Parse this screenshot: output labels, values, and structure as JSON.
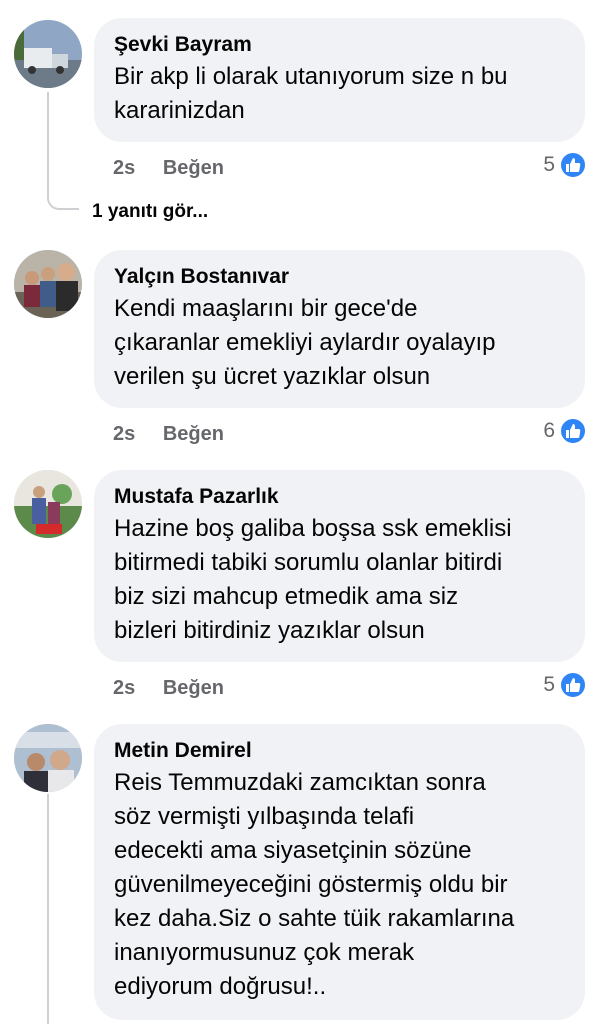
{
  "comments": [
    {
      "author": "Şevki Bayram",
      "text": "Bir akp li olarak utanıyorum size n bu\nkararinizdan",
      "time": "2s",
      "like_label": "Beğen",
      "like_count": "5"
    },
    {
      "author": "Yalçın Bostanıvar",
      "text": "Kendi maaşlarını bir gece'de\nçıkaranlar emekliyi aylardır oyalayıp\nverilen şu ücret  yazıklar olsun",
      "time": "2s",
      "like_label": "Beğen",
      "like_count": "6"
    },
    {
      "author": "Mustafa Pazarlık",
      "text": "Hazine boş galiba boşsa ssk emeklisi\nbitirmedi tabiki sorumlu olanlar bitirdi\nbiz sizi mahcup etmedik ama siz\nbizleri bitirdiniz yazıklar olsun",
      "time": "2s",
      "like_label": "Beğen",
      "like_count": "5"
    },
    {
      "author": "Metin Demirel",
      "text": "Reis Temmuzdaki zamcıktan sonra\nsöz vermişti yılbaşında telafi\nedecekti ama siyasetçinin sözüne\ngüvenilmeyeceğini göstermiş oldu bir\nkez daha.Siz o sahte tüik rakamlarına\ninanıyormusunuz çok merak\nediyorum doğrusu!.."
    }
  ],
  "replies_link": "1 yanıtı gör...",
  "icons": {
    "like": "thumbs-up-icon"
  },
  "colors": {
    "like_blue": "#2f84f6",
    "bubble": "#f0f2f5",
    "meta_gray": "#65676b"
  }
}
